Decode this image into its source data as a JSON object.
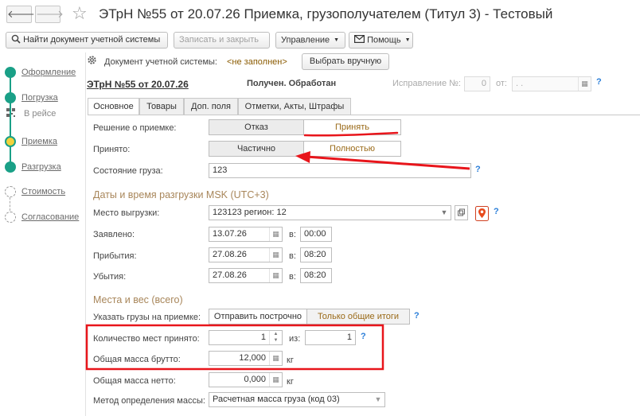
{
  "window": {
    "title": "ЭТрН №55 от 20.07.26 Приемка, грузополучателем (Титул 3) - Тестовый",
    "back_arrow": "🡐",
    "forward_arrow": "🡒",
    "star": "☆"
  },
  "toolbar": {
    "find_doc": "Найти документ учетной системы",
    "save_close": "Записать и закрыть",
    "manage": "Управление",
    "help": "Помощь"
  },
  "sidebar": {
    "steps": [
      {
        "label": "Оформление"
      },
      {
        "label": "Погрузка"
      },
      {
        "label": "В рейсе"
      },
      {
        "label": "Приемка"
      },
      {
        "label": "Разгрузка"
      },
      {
        "label": "Стоимость"
      },
      {
        "label": "Согласование"
      }
    ]
  },
  "header": {
    "doc_label": "Документ учетной системы:",
    "doc_value": "<не заполнен>",
    "choose_btn": "Выбрать вручную",
    "doc_title": "ЭТрН №55 от 20.07.26",
    "status": "Получен. Обработан",
    "correction_label": "Исправление №:",
    "correction_value": "0",
    "from_label": "от:",
    "from_value": ". ."
  },
  "tabs": [
    "Основное",
    "Товары",
    "Доп. поля",
    "Отметки, Акты, Штрафы"
  ],
  "form": {
    "decision_label": "Решение о приемке:",
    "decision_reject": "Отказ",
    "decision_accept": "Принять",
    "accepted_label": "Принято:",
    "accepted_partial": "Частично",
    "accepted_full": "Полностью",
    "cargo_state_label": "Состояние груза:",
    "cargo_state_value": "123",
    "dates_section": "Даты и время разгрузки MSK (UTC+3)",
    "place_label": "Место выгрузки:",
    "place_value": "123123 регион: 12",
    "declared_label": "Заявлено:",
    "declared_date": "13.07.26",
    "declared_time": "00:00",
    "arrival_label": "Прибытия:",
    "arrival_date": "27.08.26",
    "arrival_time": "08:20",
    "departure_label": "Убытия:",
    "departure_date": "27.08.26",
    "departure_time": "08:20",
    "time_prefix": "в:",
    "places_section": "Места и вес (всего)",
    "specify_label": "Указать грузы на приемке:",
    "specify_per_line": "Отправить построчно",
    "specify_totals": "Только общие итоги",
    "places_accepted_label": "Количество мест принято:",
    "places_accepted_value": "1",
    "of_label": "из:",
    "places_total_value": "1",
    "gross_label": "Общая масса брутто:",
    "gross_value": "12,000",
    "net_label": "Общая масса нетто:",
    "net_value": "0,000",
    "kg": "кг",
    "method_label": "Метод определения массы:",
    "method_value": "Расчетная масса груза (код 03)",
    "qmark": "?"
  },
  "colors": {
    "accent_green": "#1aa087",
    "highlight_red": "#e8151b",
    "section_brown": "#a8865a"
  }
}
